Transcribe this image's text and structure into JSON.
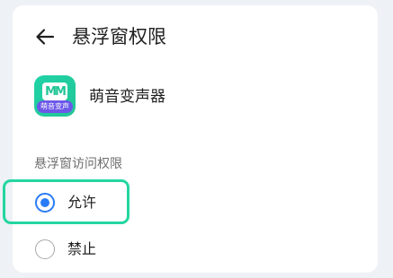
{
  "header": {
    "back_icon": "arrow-left-icon",
    "title": "悬浮窗权限"
  },
  "app": {
    "name": "萌音变声器",
    "icon": {
      "logo_text": "MM",
      "tag_text": "萌音变声",
      "colors": {
        "background": "#22c898",
        "tag": "#6b58e8"
      }
    }
  },
  "permission": {
    "section_label": "悬浮窗访问权限",
    "options": [
      {
        "label": "允许",
        "selected": true
      },
      {
        "label": "禁止",
        "selected": false
      }
    ]
  },
  "colors": {
    "accent": "#2a7cf6",
    "highlight": "#23d6a0",
    "page_background": "#eef1f5",
    "card": "#ffffff"
  }
}
